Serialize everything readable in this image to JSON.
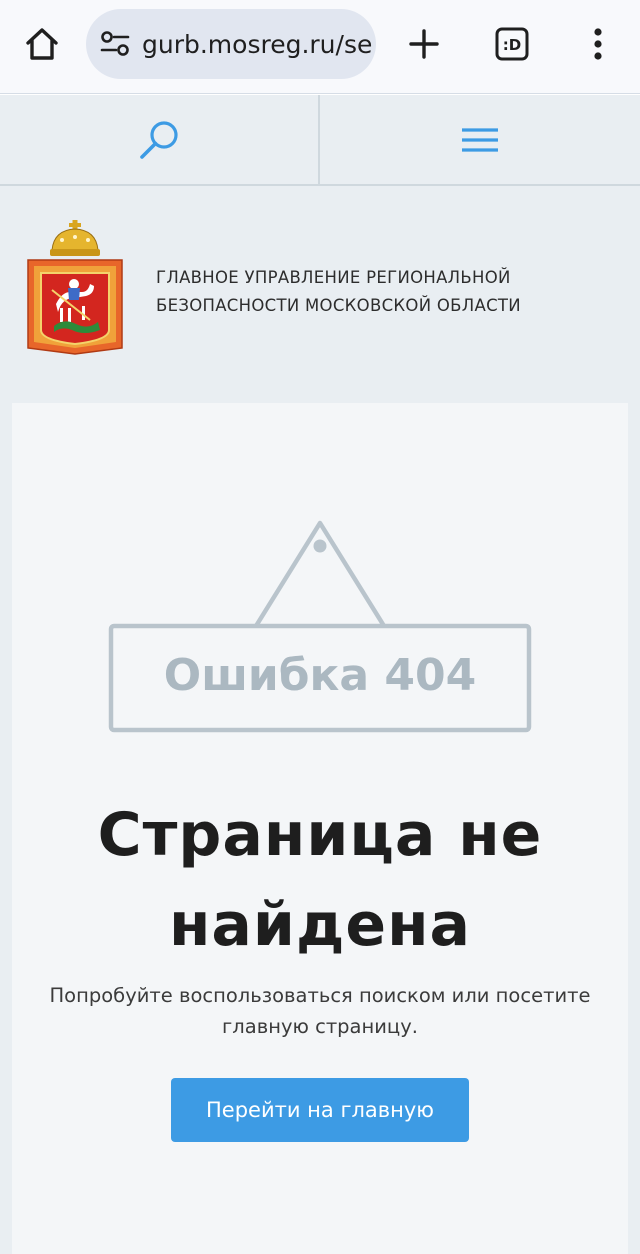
{
  "browser": {
    "url": "gurb.mosreg.ru/se",
    "icons": {
      "home": "home-icon",
      "site_info": "site-settings-icon",
      "new_tab": "plus-icon",
      "tabs": "tab-switcher-icon",
      "menu": "kebab-menu-icon"
    },
    "tab_glyph": ":D"
  },
  "site_nav": {
    "search_icon": "search-icon",
    "menu_icon": "hamburger-menu-icon",
    "accent_color": "#3d9be4"
  },
  "header": {
    "agency_name": "ГЛАВНОЕ УПРАВЛЕНИЕ РЕГИОНАЛЬНОЙ БЕЗОПАСНОСТИ МОСКОВСКОЙ ОБЛАСТИ",
    "emblem_icon": "moscow-oblast-coat-of-arms-icon"
  },
  "error": {
    "code_label": "Ошибка 404",
    "title": "Страница не найдена",
    "hint": "Попробуйте воспользоваться поиском или посетите главную страницу.",
    "button_label": "Перейти на главную",
    "button_color": "#3d9be4"
  }
}
